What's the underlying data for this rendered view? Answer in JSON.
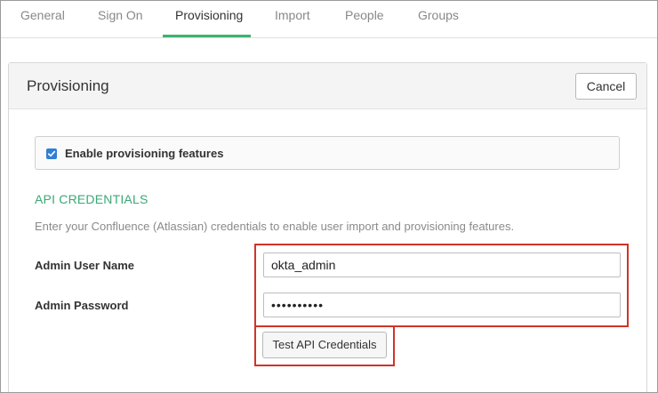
{
  "tabs": [
    {
      "label": "General",
      "active": false
    },
    {
      "label": "Sign On",
      "active": false
    },
    {
      "label": "Provisioning",
      "active": true
    },
    {
      "label": "Import",
      "active": false
    },
    {
      "label": "People",
      "active": false
    },
    {
      "label": "Groups",
      "active": false
    }
  ],
  "panel": {
    "title": "Provisioning",
    "cancel_label": "Cancel"
  },
  "provisioning": {
    "enable_label": "Enable provisioning features",
    "enabled": true
  },
  "api_credentials": {
    "section_title": "API CREDENTIALS",
    "description": "Enter your Confluence (Atlassian) credentials to enable user import and provisioning features.",
    "username_label": "Admin User Name",
    "username_value": "okta_admin",
    "password_label": "Admin Password",
    "password_value": "••••••••••",
    "test_button_label": "Test API Credentials"
  },
  "colors": {
    "accent_green": "#3cb371",
    "highlight_red": "#d03428",
    "checkbox_blue": "#2f7fd6"
  }
}
